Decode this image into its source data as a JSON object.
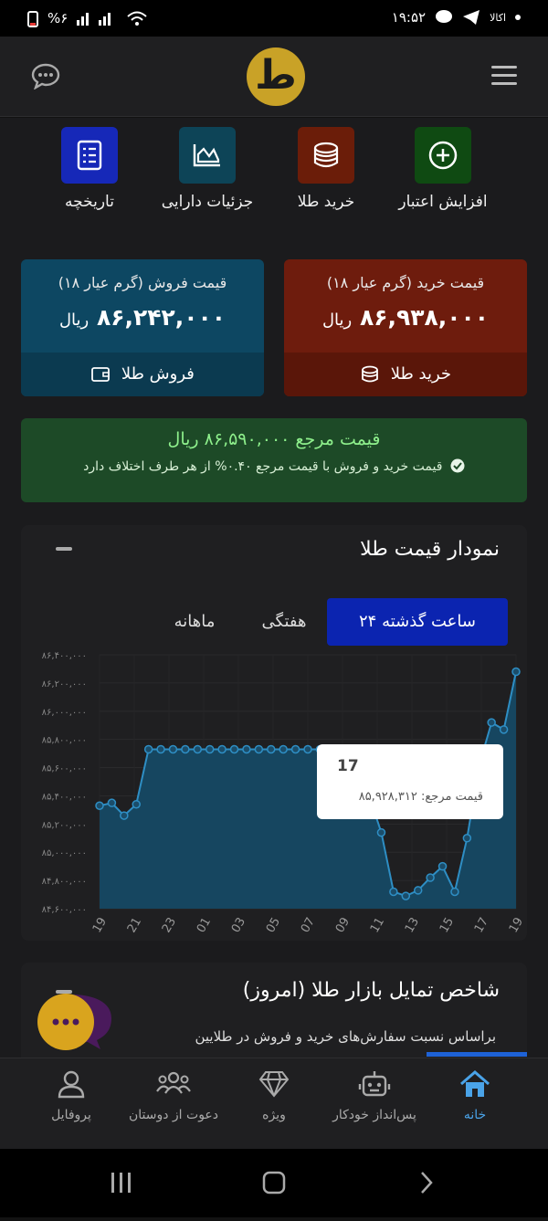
{
  "status": {
    "time": "۱۹:۵۲",
    "battery": "%۶",
    "carrier": "اکالا"
  },
  "header": {
    "logo_letter": "ط"
  },
  "quick_actions": [
    {
      "label": "افزایش اعتبار",
      "icon": "plus-circle-icon",
      "color": "#0f4a12"
    },
    {
      "label": "خرید طلا",
      "icon": "coins-stack-icon",
      "color": "#6b1d09"
    },
    {
      "label": "جزئیات دارایی",
      "icon": "chart-icon",
      "color": "#0d4457"
    },
    {
      "label": "تاریخچه",
      "icon": "list-icon",
      "color": "#1628b8"
    }
  ],
  "buy": {
    "title": "قیمت خرید (گرم عیار ۱۸)",
    "value": "۸۶,۹۳۸,۰۰۰",
    "unit": "ریال",
    "button": "خرید طلا",
    "color": "#6e1c0d"
  },
  "sell": {
    "title": "قیمت فروش (گرم عیار ۱۸)",
    "value": "۸۶,۲۴۲,۰۰۰",
    "unit": "ریال",
    "button": "فروش طلا",
    "color": "#0d4762"
  },
  "reference": {
    "title": "قیمت مرجع ۸۶,۵۹۰,۰۰۰ ریال",
    "note": "قیمت خرید و فروش با قیمت مرجع ۰.۴۰% از هر طرف اختلاف دارد"
  },
  "chart_section": {
    "title": "نمودار قیمت طلا",
    "tabs": [
      "۲۴ ساعت گذشته",
      "هفتگی",
      "ماهانه"
    ],
    "active_tab": 0,
    "tooltip": {
      "label": "17",
      "text": "قیمت مرجع: ۸۵,۹۲۸,۳۱۲"
    }
  },
  "chart_data": {
    "type": "area",
    "x_ticks": [
      "19",
      "21",
      "23",
      "01",
      "03",
      "05",
      "07",
      "09",
      "11",
      "13",
      "15",
      "17",
      "19"
    ],
    "y_ticks": [
      "۸۴,۶۰۰,۰۰۰",
      "۸۴,۸۰۰,۰۰۰",
      "۸۵,۰۰۰,۰۰۰",
      "۸۵,۲۰۰,۰۰۰",
      "۸۵,۴۰۰,۰۰۰",
      "۸۵,۶۰۰,۰۰۰",
      "۸۵,۸۰۰,۰۰۰",
      "۸۶,۰۰۰,۰۰۰",
      "۸۶,۲۰۰,۰۰۰",
      "۸۶,۴۰۰,۰۰۰"
    ],
    "ylim": [
      84600000,
      86400000
    ],
    "values": [
      85330000,
      85350000,
      85260000,
      85340000,
      85730000,
      85730000,
      85730000,
      85730000,
      85730000,
      85730000,
      85730000,
      85730000,
      85730000,
      85730000,
      85730000,
      85730000,
      85730000,
      85730000,
      85730000,
      85730000,
      85720000,
      85600000,
      85400000,
      85140000,
      84720000,
      84690000,
      84730000,
      84820000,
      84900000,
      84720000,
      85100000,
      85620000,
      85920000,
      85870000,
      86280000
    ],
    "fill_color": "#164660",
    "line_color": "#2e8ec4"
  },
  "trend": {
    "title": "شاخص تمایل بازار طلا (امروز)",
    "subtitle": "براساس نسبت سفارش‌های خرید و فروش در طلایین"
  },
  "bottom_nav": [
    {
      "label": "خانه",
      "icon": "home-icon",
      "active": true
    },
    {
      "label": "پس‌انداز خودکار",
      "icon": "robot-icon",
      "active": false
    },
    {
      "label": "ویژه",
      "icon": "diamond-icon",
      "active": false
    },
    {
      "label": "دعوت از دوستان",
      "icon": "users-icon",
      "active": false
    },
    {
      "label": "پروفایل",
      "icon": "user-icon",
      "active": false
    }
  ]
}
